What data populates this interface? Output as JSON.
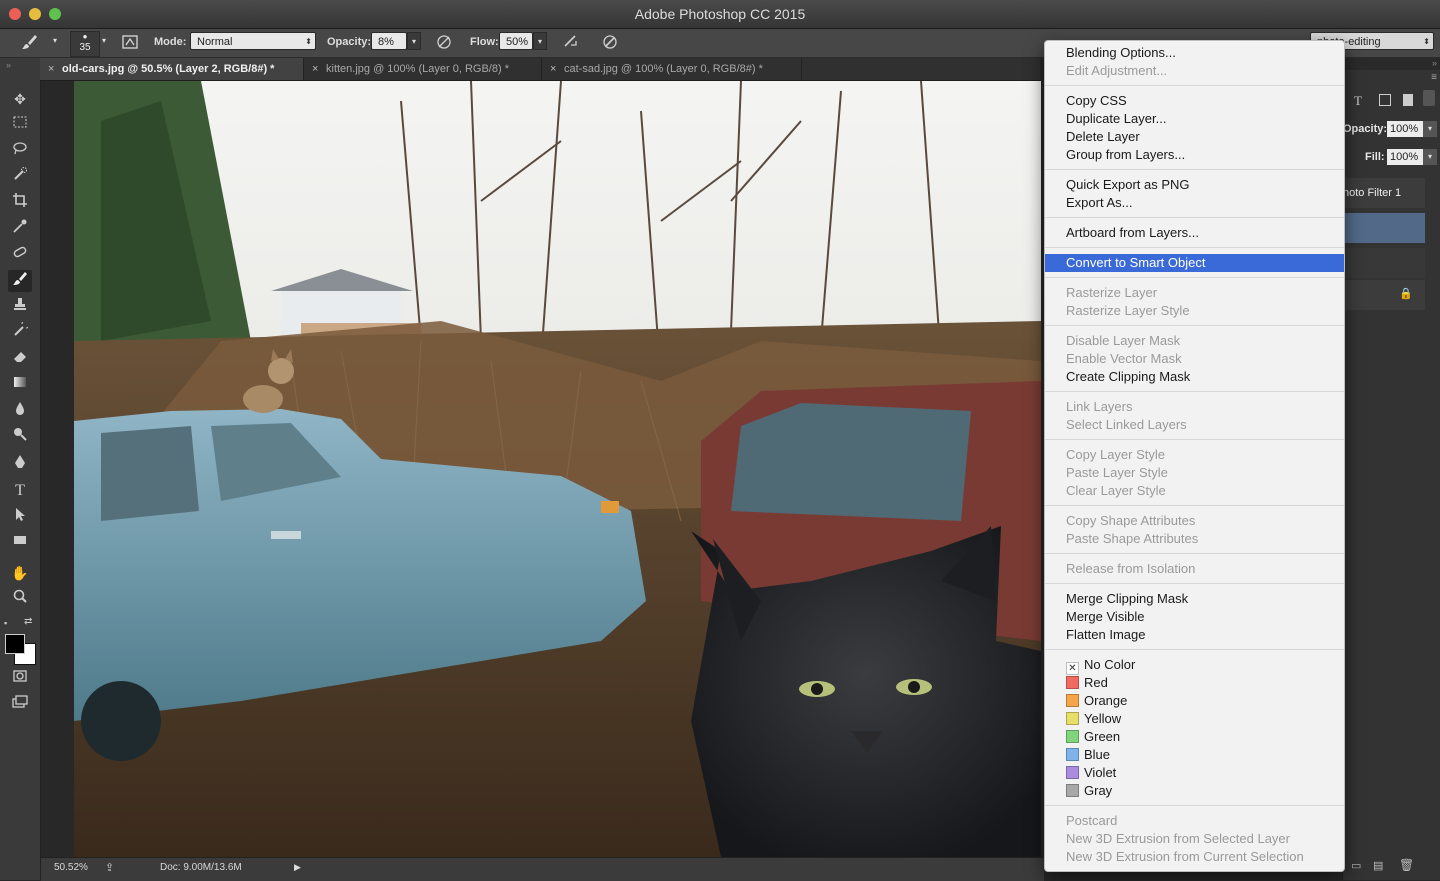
{
  "window": {
    "title": "Adobe Photoshop CC 2015"
  },
  "options_bar": {
    "brush_size": "35",
    "mode_label": "Mode:",
    "mode_value": "Normal",
    "opacity_label": "Opacity:",
    "opacity_value": "8%",
    "flow_label": "Flow:",
    "flow_value": "50%",
    "workspace": "photo-editing"
  },
  "tabs": [
    {
      "label": "old-cars.jpg @ 50.5% (Layer 2, RGB/8#) *"
    },
    {
      "label": "kitten.jpg @ 100% (Layer 0, RGB/8) *"
    },
    {
      "label": "cat-sad.jpg @ 100% (Layer 0, RGB/8#) *"
    }
  ],
  "layers_panel": {
    "opacity_label": "Opacity:",
    "opacity_value": "100%",
    "fill_label": "Fill:",
    "fill_value": "100%",
    "layer_name": "hoto Filter 1"
  },
  "status_bar": {
    "zoom": "50.52%",
    "doc": "Doc: 9.00M/13.6M"
  },
  "colors": {
    "menu_highlight": "#3a6ad8",
    "menu_bg": "#f2f2f2",
    "chrome": "#3a3a3a"
  },
  "context_menu": {
    "groups": [
      [
        {
          "label": "Blending Options...",
          "enabled": true
        },
        {
          "label": "Edit Adjustment...",
          "enabled": false
        }
      ],
      [
        {
          "label": "Copy CSS",
          "enabled": true
        },
        {
          "label": "Duplicate Layer...",
          "enabled": true
        },
        {
          "label": "Delete Layer",
          "enabled": true
        },
        {
          "label": "Group from Layers...",
          "enabled": true
        }
      ],
      [
        {
          "label": "Quick Export as PNG",
          "enabled": true
        },
        {
          "label": "Export As...",
          "enabled": true
        }
      ],
      [
        {
          "label": "Artboard from Layers...",
          "enabled": true
        }
      ],
      [
        {
          "label": "Convert to Smart Object",
          "enabled": true,
          "highlighted": true
        }
      ],
      [
        {
          "label": "Rasterize Layer",
          "enabled": false
        },
        {
          "label": "Rasterize Layer Style",
          "enabled": false
        }
      ],
      [
        {
          "label": "Disable Layer Mask",
          "enabled": false
        },
        {
          "label": "Enable Vector Mask",
          "enabled": false
        },
        {
          "label": "Create Clipping Mask",
          "enabled": true
        }
      ],
      [
        {
          "label": "Link Layers",
          "enabled": false
        },
        {
          "label": "Select Linked Layers",
          "enabled": false
        }
      ],
      [
        {
          "label": "Copy Layer Style",
          "enabled": false
        },
        {
          "label": "Paste Layer Style",
          "enabled": false
        },
        {
          "label": "Clear Layer Style",
          "enabled": false
        }
      ],
      [
        {
          "label": "Copy Shape Attributes",
          "enabled": false
        },
        {
          "label": "Paste Shape Attributes",
          "enabled": false
        }
      ],
      [
        {
          "label": "Release from Isolation",
          "enabled": false
        }
      ],
      [
        {
          "label": "Merge Clipping Mask",
          "enabled": true
        },
        {
          "label": "Merge Visible",
          "enabled": true
        },
        {
          "label": "Flatten Image",
          "enabled": true
        }
      ],
      [
        {
          "label": "No Color",
          "enabled": true,
          "color": "none"
        },
        {
          "label": "Red",
          "enabled": true,
          "color": "#f06a62"
        },
        {
          "label": "Orange",
          "enabled": true,
          "color": "#f5a64a"
        },
        {
          "label": "Yellow",
          "enabled": true,
          "color": "#e8de6a"
        },
        {
          "label": "Green",
          "enabled": true,
          "color": "#7fd47c"
        },
        {
          "label": "Blue",
          "enabled": true,
          "color": "#7eb3ec"
        },
        {
          "label": "Violet",
          "enabled": true,
          "color": "#a98be0"
        },
        {
          "label": "Gray",
          "enabled": true,
          "color": "#a8a8a8"
        }
      ],
      [
        {
          "label": "Postcard",
          "enabled": false
        },
        {
          "label": "New 3D Extrusion from Selected Layer",
          "enabled": false
        },
        {
          "label": "New 3D Extrusion from Current Selection",
          "enabled": false
        }
      ]
    ]
  }
}
